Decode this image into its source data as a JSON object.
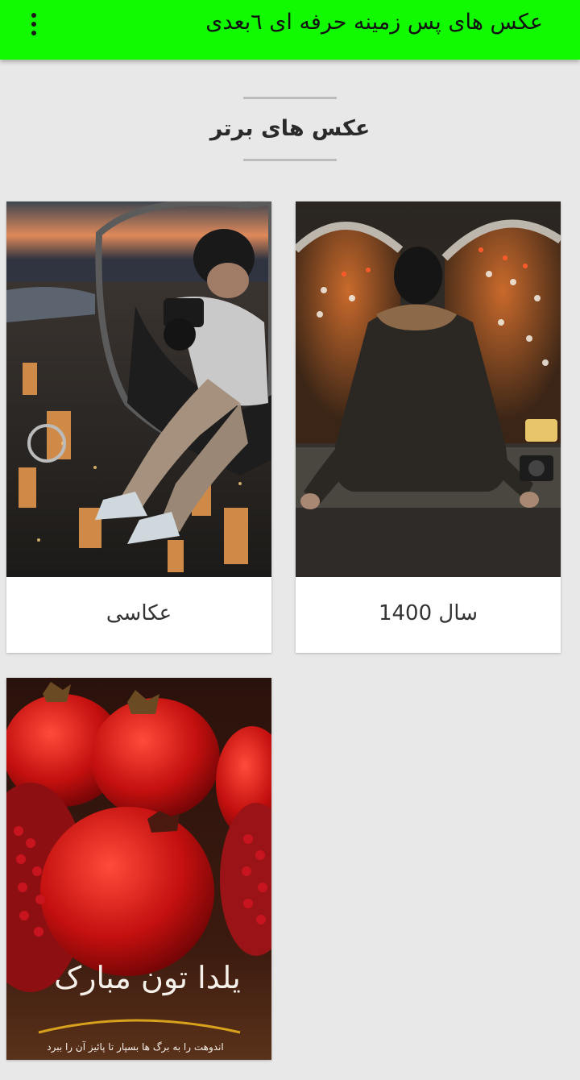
{
  "appbar": {
    "title": "عکس های پس زمینه حرفه ای ٦بعدی",
    "menu_icon": "more-vert-icon",
    "color": "#12fa00"
  },
  "section": {
    "title": "عکس های برتر"
  },
  "cards": [
    {
      "label": "سال 1400",
      "image": "man-on-ledge-over-highway-tunnel"
    },
    {
      "label": "عکاسی",
      "image": "photographer-in-helicopter-over-city"
    },
    {
      "label": "",
      "image": "pomegranates-yalda-card"
    }
  ],
  "yalda_card": {
    "calligraphy": "یلدا تون مبارک",
    "caption": "اندوهت را به برگ ها بسپار تا پائیز آن را ببرد"
  }
}
